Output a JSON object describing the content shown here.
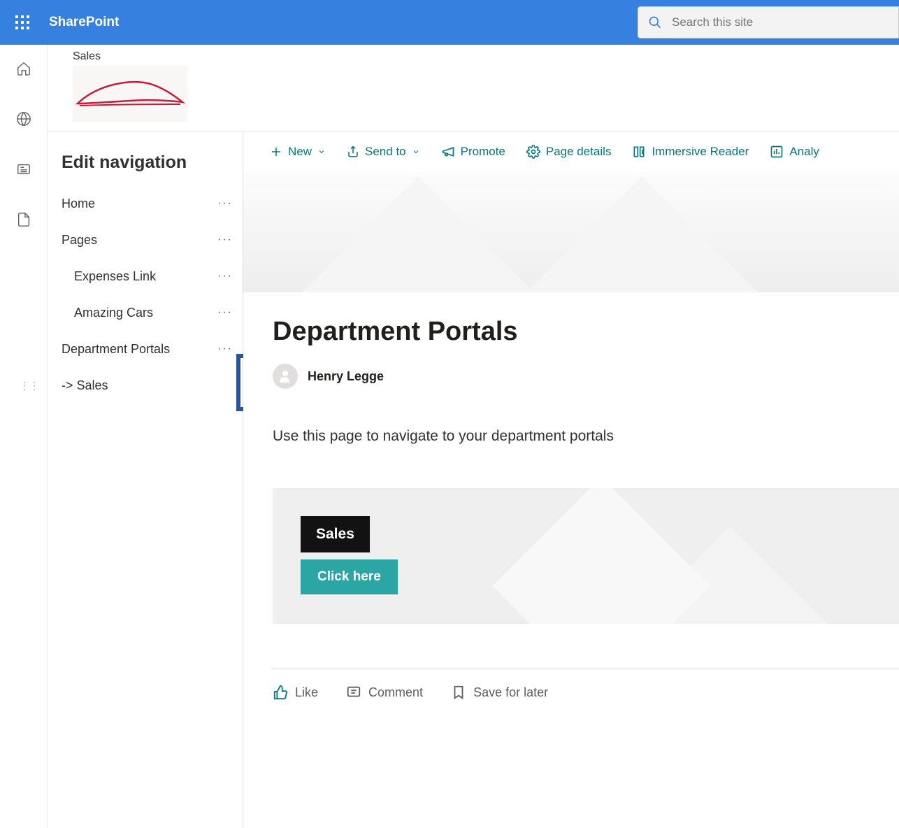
{
  "header": {
    "app_name": "SharePoint",
    "search_placeholder": "Search this site"
  },
  "site": {
    "name": "Sales"
  },
  "nav": {
    "title": "Edit navigation",
    "items": [
      {
        "label": "Home",
        "child": false
      },
      {
        "label": "Pages",
        "child": false
      },
      {
        "label": "Expenses Link",
        "child": true
      },
      {
        "label": "Amazing Cars",
        "child": true
      },
      {
        "label": "Department Portals",
        "child": false
      },
      {
        "label": "-> Sales",
        "child": false
      }
    ]
  },
  "cmdbar": {
    "new": "New",
    "sendto": "Send to",
    "promote": "Promote",
    "pagedetails": "Page details",
    "immersive": "Immersive Reader",
    "analytics": "Analy"
  },
  "article": {
    "title": "Department Portals",
    "author": "Henry Legge",
    "description": "Use this page to navigate to your department portals"
  },
  "card": {
    "label": "Sales",
    "button": "Click here"
  },
  "reactions": {
    "like": "Like",
    "comment": "Comment",
    "save": "Save for later"
  }
}
